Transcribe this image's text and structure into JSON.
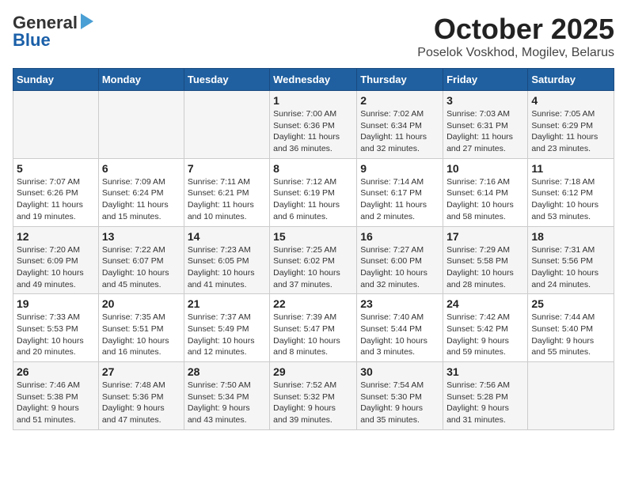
{
  "header": {
    "logo_general": "General",
    "logo_blue": "Blue",
    "month": "October 2025",
    "location": "Poselok Voskhod, Mogilev, Belarus"
  },
  "days_of_week": [
    "Sunday",
    "Monday",
    "Tuesday",
    "Wednesday",
    "Thursday",
    "Friday",
    "Saturday"
  ],
  "weeks": [
    [
      {
        "day": "",
        "info": ""
      },
      {
        "day": "",
        "info": ""
      },
      {
        "day": "",
        "info": ""
      },
      {
        "day": "1",
        "info": "Sunrise: 7:00 AM\nSunset: 6:36 PM\nDaylight: 11 hours\nand 36 minutes."
      },
      {
        "day": "2",
        "info": "Sunrise: 7:02 AM\nSunset: 6:34 PM\nDaylight: 11 hours\nand 32 minutes."
      },
      {
        "day": "3",
        "info": "Sunrise: 7:03 AM\nSunset: 6:31 PM\nDaylight: 11 hours\nand 27 minutes."
      },
      {
        "day": "4",
        "info": "Sunrise: 7:05 AM\nSunset: 6:29 PM\nDaylight: 11 hours\nand 23 minutes."
      }
    ],
    [
      {
        "day": "5",
        "info": "Sunrise: 7:07 AM\nSunset: 6:26 PM\nDaylight: 11 hours\nand 19 minutes."
      },
      {
        "day": "6",
        "info": "Sunrise: 7:09 AM\nSunset: 6:24 PM\nDaylight: 11 hours\nand 15 minutes."
      },
      {
        "day": "7",
        "info": "Sunrise: 7:11 AM\nSunset: 6:21 PM\nDaylight: 11 hours\nand 10 minutes."
      },
      {
        "day": "8",
        "info": "Sunrise: 7:12 AM\nSunset: 6:19 PM\nDaylight: 11 hours\nand 6 minutes."
      },
      {
        "day": "9",
        "info": "Sunrise: 7:14 AM\nSunset: 6:17 PM\nDaylight: 11 hours\nand 2 minutes."
      },
      {
        "day": "10",
        "info": "Sunrise: 7:16 AM\nSunset: 6:14 PM\nDaylight: 10 hours\nand 58 minutes."
      },
      {
        "day": "11",
        "info": "Sunrise: 7:18 AM\nSunset: 6:12 PM\nDaylight: 10 hours\nand 53 minutes."
      }
    ],
    [
      {
        "day": "12",
        "info": "Sunrise: 7:20 AM\nSunset: 6:09 PM\nDaylight: 10 hours\nand 49 minutes."
      },
      {
        "day": "13",
        "info": "Sunrise: 7:22 AM\nSunset: 6:07 PM\nDaylight: 10 hours\nand 45 minutes."
      },
      {
        "day": "14",
        "info": "Sunrise: 7:23 AM\nSunset: 6:05 PM\nDaylight: 10 hours\nand 41 minutes."
      },
      {
        "day": "15",
        "info": "Sunrise: 7:25 AM\nSunset: 6:02 PM\nDaylight: 10 hours\nand 37 minutes."
      },
      {
        "day": "16",
        "info": "Sunrise: 7:27 AM\nSunset: 6:00 PM\nDaylight: 10 hours\nand 32 minutes."
      },
      {
        "day": "17",
        "info": "Sunrise: 7:29 AM\nSunset: 5:58 PM\nDaylight: 10 hours\nand 28 minutes."
      },
      {
        "day": "18",
        "info": "Sunrise: 7:31 AM\nSunset: 5:56 PM\nDaylight: 10 hours\nand 24 minutes."
      }
    ],
    [
      {
        "day": "19",
        "info": "Sunrise: 7:33 AM\nSunset: 5:53 PM\nDaylight: 10 hours\nand 20 minutes."
      },
      {
        "day": "20",
        "info": "Sunrise: 7:35 AM\nSunset: 5:51 PM\nDaylight: 10 hours\nand 16 minutes."
      },
      {
        "day": "21",
        "info": "Sunrise: 7:37 AM\nSunset: 5:49 PM\nDaylight: 10 hours\nand 12 minutes."
      },
      {
        "day": "22",
        "info": "Sunrise: 7:39 AM\nSunset: 5:47 PM\nDaylight: 10 hours\nand 8 minutes."
      },
      {
        "day": "23",
        "info": "Sunrise: 7:40 AM\nSunset: 5:44 PM\nDaylight: 10 hours\nand 3 minutes."
      },
      {
        "day": "24",
        "info": "Sunrise: 7:42 AM\nSunset: 5:42 PM\nDaylight: 9 hours\nand 59 minutes."
      },
      {
        "day": "25",
        "info": "Sunrise: 7:44 AM\nSunset: 5:40 PM\nDaylight: 9 hours\nand 55 minutes."
      }
    ],
    [
      {
        "day": "26",
        "info": "Sunrise: 7:46 AM\nSunset: 5:38 PM\nDaylight: 9 hours\nand 51 minutes."
      },
      {
        "day": "27",
        "info": "Sunrise: 7:48 AM\nSunset: 5:36 PM\nDaylight: 9 hours\nand 47 minutes."
      },
      {
        "day": "28",
        "info": "Sunrise: 7:50 AM\nSunset: 5:34 PM\nDaylight: 9 hours\nand 43 minutes."
      },
      {
        "day": "29",
        "info": "Sunrise: 7:52 AM\nSunset: 5:32 PM\nDaylight: 9 hours\nand 39 minutes."
      },
      {
        "day": "30",
        "info": "Sunrise: 7:54 AM\nSunset: 5:30 PM\nDaylight: 9 hours\nand 35 minutes."
      },
      {
        "day": "31",
        "info": "Sunrise: 7:56 AM\nSunset: 5:28 PM\nDaylight: 9 hours\nand 31 minutes."
      },
      {
        "day": "",
        "info": ""
      }
    ]
  ]
}
